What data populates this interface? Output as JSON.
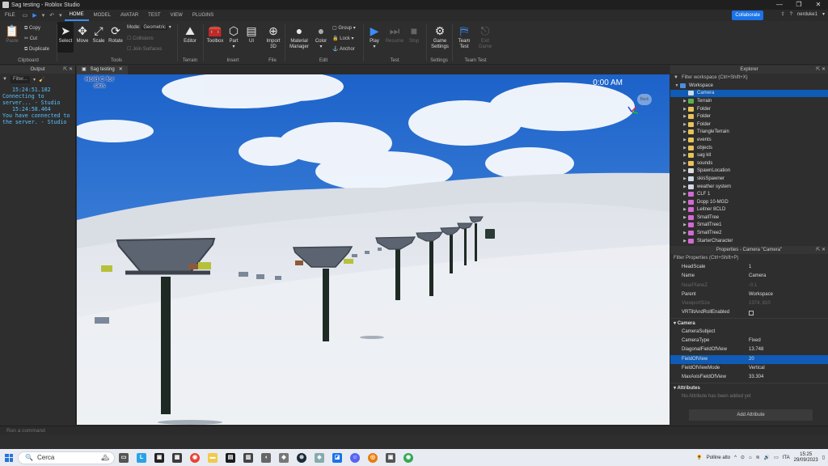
{
  "window": {
    "title": "Sag testing - Roblox Studio",
    "controls": [
      "—",
      "❐",
      "✕"
    ]
  },
  "menubar": {
    "file": "FILE",
    "tabs": [
      "HOME",
      "MODEL",
      "AVATAR",
      "TEST",
      "VIEW",
      "PLUGINS"
    ],
    "active_tab": "HOME",
    "collaborate": "Collaborate",
    "user": "nerduke1"
  },
  "ribbon": {
    "clipboard": {
      "label": "Clipboard",
      "paste": "Paste",
      "copy": "Copy",
      "cut": "Cut",
      "duplicate": "Duplicate"
    },
    "tools": {
      "label": "Tools",
      "select": "Select",
      "move": "Move",
      "scale": "Scale",
      "rotate": "Rotate",
      "mode_label": "Mode:",
      "mode_value": "Geometric",
      "collisions": "Collisions",
      "join_surfaces": "Join Surfaces"
    },
    "terrain": {
      "label": "Terrain",
      "editor": "Editor"
    },
    "insert": {
      "label": "Insert",
      "toolbox": "Toolbox",
      "part": "Part",
      "ui": "UI"
    },
    "file": {
      "label": "File",
      "import3d": [
        "Import",
        "3D"
      ]
    },
    "edit": {
      "label": "Edit",
      "material": [
        "Material",
        "Manager"
      ],
      "color": "Color",
      "group": "Group",
      "lock": "Lock",
      "anchor": "Anchor"
    },
    "test": {
      "label": "Test",
      "play": "Play",
      "resume": "Resume",
      "stop": "Stop"
    },
    "settings": {
      "label": "Settings",
      "game_settings": [
        "Game",
        "Settings"
      ]
    },
    "team_test": {
      "label": "Team Test",
      "team_test": [
        "Team",
        "Test"
      ],
      "exit_game": [
        "Exit",
        "Game"
      ]
    }
  },
  "output": {
    "title": "Output",
    "filter": "Filter...",
    "lines": [
      "15:24:51.182",
      "Connecting to server... - Studio",
      "15:24:58.464",
      "You have connected to the server. - Studio"
    ]
  },
  "document": {
    "tab": "Sag testing"
  },
  "viewport": {
    "hint_lines": [
      "Hold C for",
      "skis"
    ],
    "clock": "0:00 AM",
    "back": "Back"
  },
  "explorer": {
    "title": "Explorer",
    "filter": "Filter workspace (Ctrl+Shift+X)",
    "items": [
      {
        "label": "Workspace",
        "icon": "workspace-icon",
        "color": "#4a8fe0",
        "depth": 0,
        "arrow": "▼",
        "selected": false
      },
      {
        "label": "Camera",
        "icon": "camera-icon",
        "color": "#cfd8e3",
        "depth": 1,
        "arrow": "",
        "selected": true
      },
      {
        "label": "Terrain",
        "icon": "terrain-icon",
        "color": "#5bb04c",
        "depth": 1,
        "arrow": "▶",
        "selected": false
      },
      {
        "label": "Folder",
        "icon": "folder-icon",
        "color": "#e8c25a",
        "depth": 1,
        "arrow": "▶",
        "selected": false
      },
      {
        "label": "Folder",
        "icon": "folder-icon",
        "color": "#e8c25a",
        "depth": 1,
        "arrow": "▶",
        "selected": false
      },
      {
        "label": "Folder",
        "icon": "folder-icon",
        "color": "#e8c25a",
        "depth": 1,
        "arrow": "▶",
        "selected": false
      },
      {
        "label": "TriangleTerrain",
        "icon": "folder-icon",
        "color": "#e8c25a",
        "depth": 1,
        "arrow": "▶",
        "selected": false
      },
      {
        "label": "events",
        "icon": "folder-icon",
        "color": "#e8c25a",
        "depth": 1,
        "arrow": "▶",
        "selected": false
      },
      {
        "label": "objects",
        "icon": "folder-icon",
        "color": "#e8c25a",
        "depth": 1,
        "arrow": "▶",
        "selected": false
      },
      {
        "label": "sag kit",
        "icon": "folder-icon",
        "color": "#e8c25a",
        "depth": 1,
        "arrow": "▶",
        "selected": false
      },
      {
        "label": "sounds",
        "icon": "folder-icon",
        "color": "#e8c25a",
        "depth": 1,
        "arrow": "▶",
        "selected": false
      },
      {
        "label": "SpawnLocation",
        "icon": "spawn-icon",
        "color": "#dddddd",
        "depth": 1,
        "arrow": "▶",
        "selected": false
      },
      {
        "label": "skisSpawner",
        "icon": "script-icon",
        "color": "#cfd8e3",
        "depth": 1,
        "arrow": "▶",
        "selected": false
      },
      {
        "label": "weather system",
        "icon": "script-icon",
        "color": "#cfd8e3",
        "depth": 1,
        "arrow": "▶",
        "selected": false
      },
      {
        "label": "CLF 1",
        "icon": "model-icon",
        "color": "#d36ad1",
        "depth": 1,
        "arrow": "▶",
        "selected": false
      },
      {
        "label": "Dopp 10-MGD",
        "icon": "model-icon",
        "color": "#d36ad1",
        "depth": 1,
        "arrow": "▶",
        "selected": false
      },
      {
        "label": "Leitner 8CLD",
        "icon": "model-icon",
        "color": "#d36ad1",
        "depth": 1,
        "arrow": "▶",
        "selected": false
      },
      {
        "label": "SmallTree",
        "icon": "model-icon",
        "color": "#d36ad1",
        "depth": 1,
        "arrow": "▶",
        "selected": false
      },
      {
        "label": "SmallTree1",
        "icon": "model-icon",
        "color": "#d36ad1",
        "depth": 1,
        "arrow": "▶",
        "selected": false
      },
      {
        "label": "SmallTree2",
        "icon": "model-icon",
        "color": "#d36ad1",
        "depth": 1,
        "arrow": "▶",
        "selected": false
      },
      {
        "label": "StarterCharacter",
        "icon": "model-icon",
        "color": "#d36ad1",
        "depth": 1,
        "arrow": "▶",
        "selected": false
      }
    ]
  },
  "properties": {
    "title": "Properties - Camera \"Camera\"",
    "filter": "Filter Properties (Ctrl+Shift+P)",
    "rows": [
      {
        "name": "HeadScale",
        "value": "1",
        "dim": false,
        "selected": false,
        "checkbox": false
      },
      {
        "name": "Name",
        "value": "Camera",
        "dim": false,
        "selected": false,
        "checkbox": false
      },
      {
        "name": "NearPlaneZ",
        "value": "-0.1",
        "dim": true,
        "selected": false,
        "checkbox": false
      },
      {
        "name": "Parent",
        "value": "Workspace",
        "dim": false,
        "selected": false,
        "checkbox": false
      },
      {
        "name": "ViewportSize",
        "value": "1374, 810",
        "dim": true,
        "selected": false,
        "checkbox": false
      },
      {
        "name": "VRTiltAndRollEnabled",
        "value": "",
        "dim": false,
        "selected": false,
        "checkbox": true
      }
    ],
    "camera_section": "Camera",
    "camera_rows": [
      {
        "name": "CameraSubject",
        "value": "",
        "dim": false,
        "selected": false
      },
      {
        "name": "CameraType",
        "value": "Fixed",
        "dim": false,
        "selected": false
      },
      {
        "name": "DiagonalFieldOfView",
        "value": "13.748",
        "dim": false,
        "selected": false
      },
      {
        "name": "FieldOfView",
        "value": "20",
        "dim": false,
        "selected": true
      },
      {
        "name": "FieldOfViewMode",
        "value": "Vertical",
        "dim": false,
        "selected": false
      },
      {
        "name": "MaxAxisFieldOfView",
        "value": "33.304",
        "dim": false,
        "selected": false
      }
    ],
    "attributes_section": "Attributes",
    "no_attributes": "No Attribute has been added yet",
    "add_attribute": "Add Attribute"
  },
  "command_bar": {
    "placeholder": "Run a command"
  },
  "taskbar": {
    "search": "Cerca",
    "weather": "Polline alto",
    "time": "15:25",
    "date": "29/09/2023",
    "lang": "ITA"
  }
}
